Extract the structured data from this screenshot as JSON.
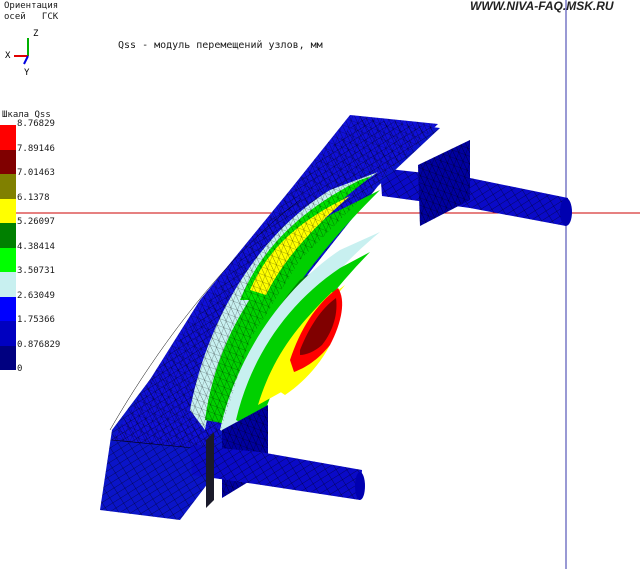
{
  "header": {
    "orientation_label": "Ориентация\nосей   ГСК",
    "watermark": "WWW.NIVA-FAQ.MSK.RU",
    "plot_title": "Qss - модуль перемещений узлов, мм"
  },
  "axes": {
    "x": "X",
    "y": "Y",
    "z": "Z"
  },
  "scale": {
    "title": "Шкала Qss",
    "items": [
      {
        "value": "8.76829",
        "color": "#ff0000"
      },
      {
        "value": "7.89146",
        "color": "#800000"
      },
      {
        "value": "7.01463",
        "color": "#808000"
      },
      {
        "value": "6.1378",
        "color": "#ffff00"
      },
      {
        "value": "5.26097",
        "color": "#008000"
      },
      {
        "value": "4.38414",
        "color": "#00ff00"
      },
      {
        "value": "3.50731",
        "color": "#c8f0f0"
      },
      {
        "value": "2.63049",
        "color": "#0000ff"
      },
      {
        "value": "1.75366",
        "color": "#0000c0"
      },
      {
        "value": "0.876829",
        "color": "#000080"
      },
      {
        "value": "0",
        "color": ""
      }
    ]
  }
}
